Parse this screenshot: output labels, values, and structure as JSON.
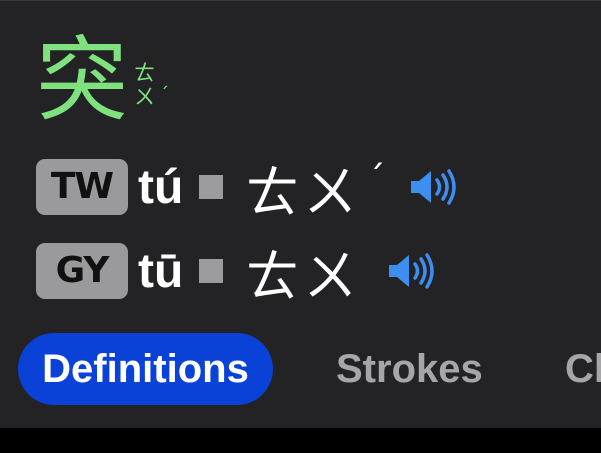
{
  "entry": {
    "character": "突",
    "ruby": {
      "line1": "ㄊ",
      "line2": "ㄨ",
      "tone": "ˊ"
    }
  },
  "readings": [
    {
      "badge": "TW",
      "pinyin": "tú",
      "zhuyin": "ㄊㄨ",
      "tone": "ˊ"
    },
    {
      "badge": "GY",
      "pinyin": "tū",
      "zhuyin": "ㄊㄨ",
      "tone": ""
    }
  ],
  "icons": {
    "speaker": "speaker-volume-icon",
    "separator": "square-separator"
  },
  "tabs": [
    {
      "label": "Definitions",
      "active": true
    },
    {
      "label": "Strokes",
      "active": false
    },
    {
      "label": "Cl",
      "active": false
    }
  ],
  "colors": {
    "character": "#7fe27f",
    "speaker": "#3e8ef0",
    "active_tab": "#0a42d8",
    "badge": "#9a9a9c",
    "background": "#232325"
  }
}
